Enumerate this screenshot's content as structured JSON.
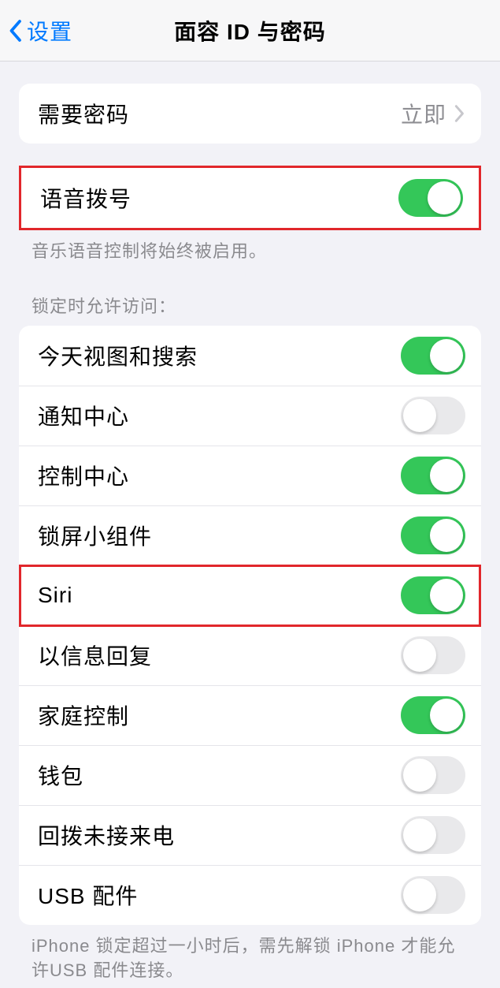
{
  "nav": {
    "back_label": "设置",
    "title": "面容 ID 与密码"
  },
  "passcode": {
    "require_label": "需要密码",
    "require_value": "立即"
  },
  "voice_dial": {
    "label": "语音拨号",
    "footer": "音乐语音控制将始终被启用。"
  },
  "lock_access": {
    "header": "锁定时允许访问：",
    "items": [
      {
        "label": "今天视图和搜索",
        "on": true
      },
      {
        "label": "通知中心",
        "on": false
      },
      {
        "label": "控制中心",
        "on": true
      },
      {
        "label": "锁屏小组件",
        "on": true
      },
      {
        "label": "Siri",
        "on": true
      },
      {
        "label": "以信息回复",
        "on": false
      },
      {
        "label": "家庭控制",
        "on": true
      },
      {
        "label": "钱包",
        "on": false
      },
      {
        "label": "回拨未接来电",
        "on": false
      },
      {
        "label": "USB 配件",
        "on": false
      }
    ],
    "footer": "iPhone 锁定超过一小时后，需先解锁 iPhone 才能允许USB 配件连接。"
  }
}
